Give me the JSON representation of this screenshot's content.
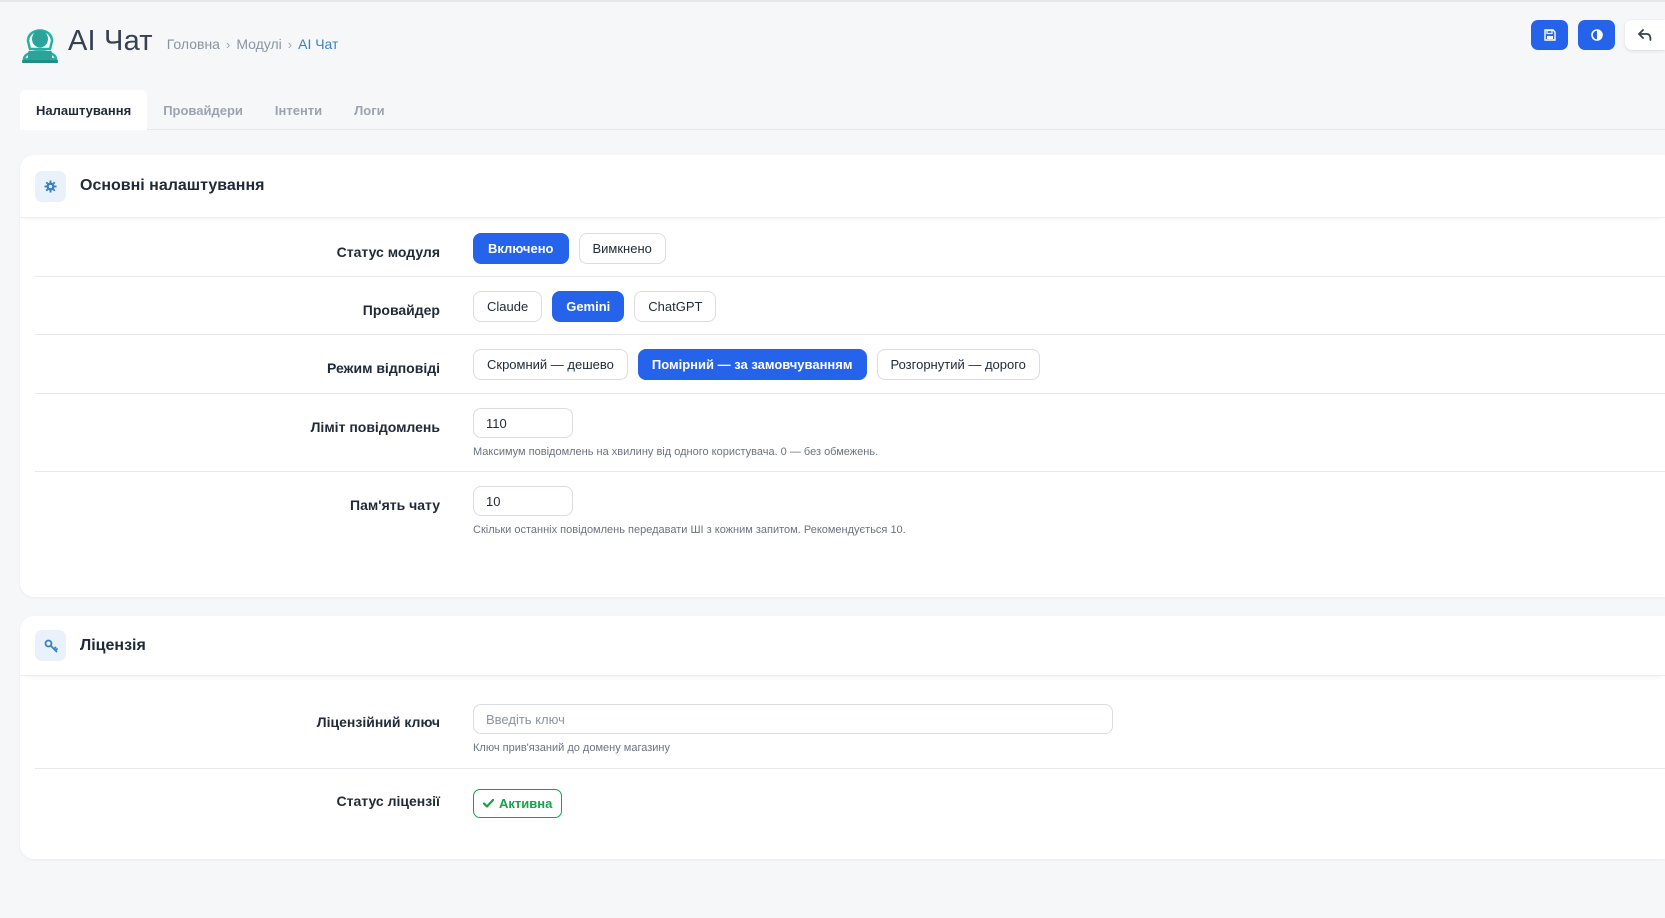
{
  "app": {
    "title": "AI Чат",
    "logo_icon": "hooded-person-laptop-icon"
  },
  "breadcrumb": [
    {
      "label": "Головна"
    },
    {
      "label": "Модулі"
    },
    {
      "label": "AI Чат"
    }
  ],
  "header_actions": [
    {
      "icon": "save-icon"
    },
    {
      "icon": "contrast-icon"
    },
    {
      "icon": "back-arrow-icon"
    }
  ],
  "tabs": [
    {
      "label": "Налаштування",
      "active": true
    },
    {
      "label": "Провайдери",
      "active": false
    },
    {
      "label": "Інтенти",
      "active": false
    },
    {
      "label": "Логи",
      "active": false
    }
  ],
  "main_settings": {
    "title": "Основні налаштування",
    "icon": "gear-icon",
    "module_status": {
      "label": "Статус модуля",
      "options": [
        "Включено",
        "Вимкнено"
      ],
      "selected": "Включено"
    },
    "provider": {
      "label": "Провайдер",
      "options": [
        "Claude",
        "Gemini",
        "ChatGPT"
      ],
      "selected": "Gemini"
    },
    "response_mode": {
      "label": "Режим відповіді",
      "options": [
        "Скромний — дешево",
        "Помірний — за замовчуванням",
        "Розгорнутий — дорого"
      ],
      "selected": "Помірний — за замовчуванням"
    },
    "message_limit": {
      "label": "Ліміт повідомлень",
      "value": "110",
      "hint": "Максимум повідомлень на хвилину від одного користувача. 0 — без обмежень."
    },
    "chat_memory": {
      "label": "Пам'ять чату",
      "value": "10",
      "hint": "Скільки останніх повідомлень передавати ШІ з кожним запитом. Рекомендується 10."
    }
  },
  "license": {
    "title": "Ліцензія",
    "icon": "key-icon",
    "key": {
      "label": "Ліцензійний ключ",
      "placeholder": "Введіть ключ",
      "value": "",
      "hint": "Ключ прив'язаний до домену магазину"
    },
    "status": {
      "label": "Статус ліцензії",
      "badge": "Активна",
      "badge_icon": "check-icon"
    }
  },
  "colors": {
    "accent": "#2563eb",
    "success": "#16a34a",
    "link": "#3b82c4"
  }
}
